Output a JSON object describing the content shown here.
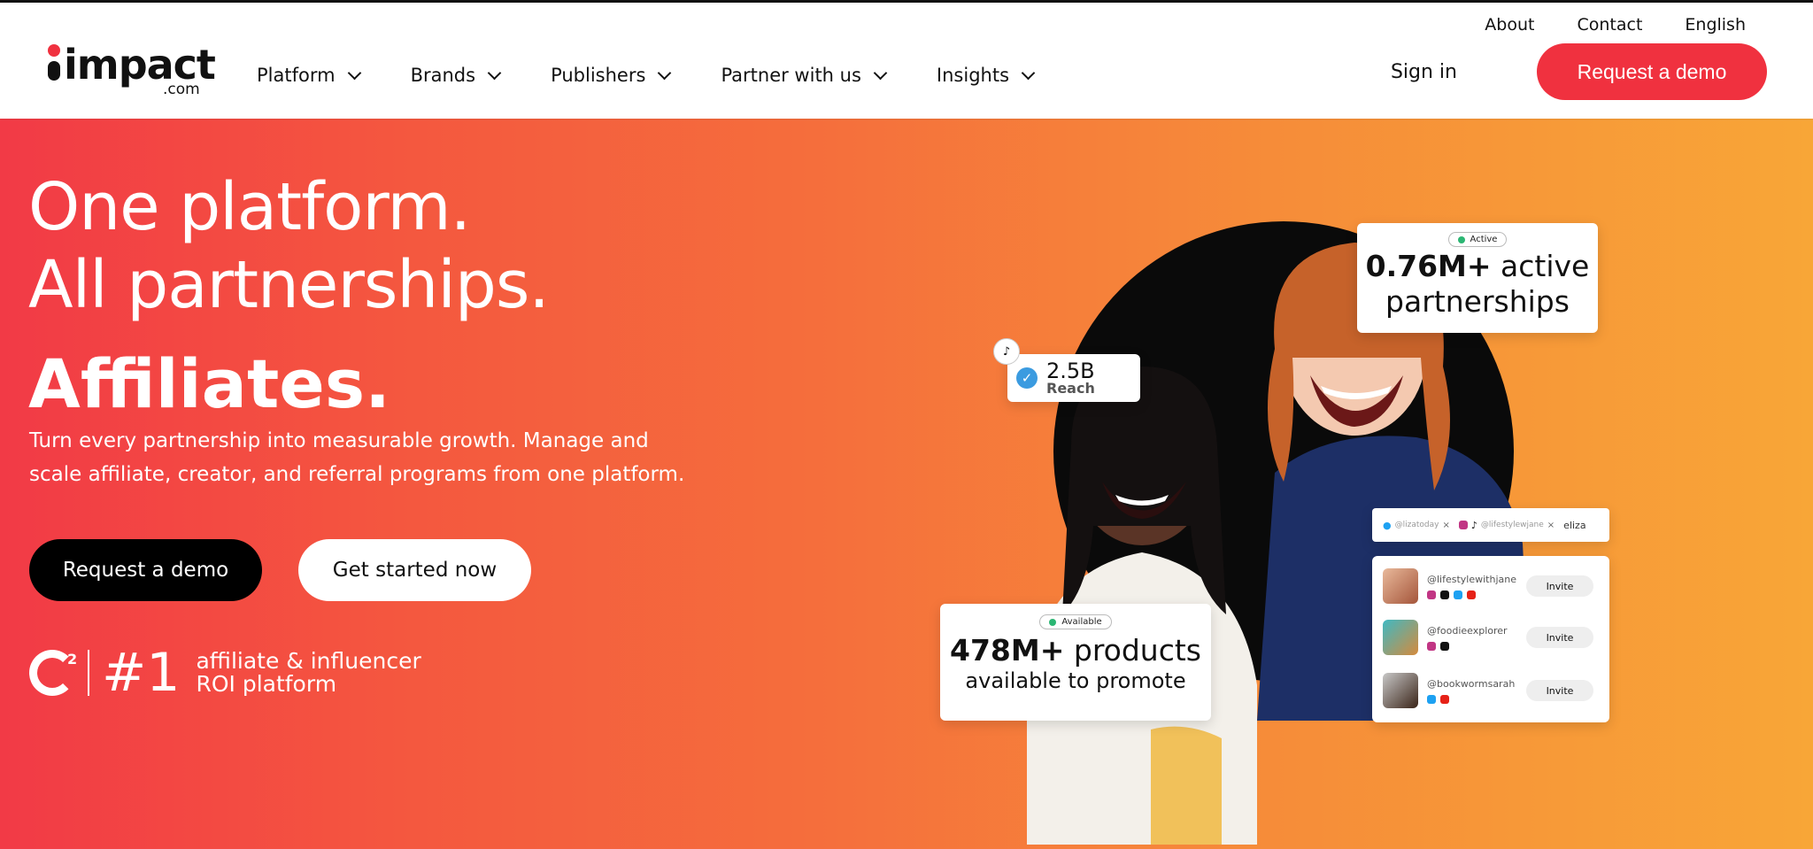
{
  "header": {
    "logo_text": "impact",
    "logo_suffix": ".com",
    "nav": [
      {
        "label": "Platform"
      },
      {
        "label": "Brands"
      },
      {
        "label": "Publishers"
      },
      {
        "label": "Partner with us"
      },
      {
        "label": "Insights"
      }
    ],
    "utility": {
      "about": "About",
      "contact": "Contact",
      "language": "English"
    },
    "sign_in": "Sign in",
    "cta": "Request a demo"
  },
  "hero": {
    "line1": "One platform.",
    "line2": "All partnerships.",
    "rotating_word": "Affiliates.",
    "subtitle": "Turn every partnership into measurable growth. Manage and scale affiliate, creator, and referral programs from one platform.",
    "btn_primary": "Request a demo",
    "btn_secondary": "Get started now",
    "g2": {
      "sup": "2",
      "rank": "#1",
      "line1": "affiliate & influencer",
      "line2": "ROI platform"
    }
  },
  "cards": {
    "active": {
      "badge": "Active",
      "number": "0.76M+",
      "text1": "active",
      "text2": "partnerships"
    },
    "reach": {
      "number": "2.5B",
      "label": "Reach"
    },
    "products": {
      "badge": "Available",
      "number": "478M+",
      "text1": "products",
      "text2": "available to promote"
    },
    "search": {
      "tag1": "@lizatoday",
      "tag2": "@lifestylewjane",
      "query": "eliza"
    },
    "creators": [
      {
        "handle": "@lifestylewithjane",
        "action": "Invite"
      },
      {
        "handle": "@foodieexplorer",
        "action": "Invite"
      },
      {
        "handle": "@bookwormsarah",
        "action": "Invite"
      }
    ]
  },
  "colors": {
    "brand_red": "#f0313f",
    "gradient_start": "#f23a46",
    "gradient_end": "#f8a637"
  }
}
